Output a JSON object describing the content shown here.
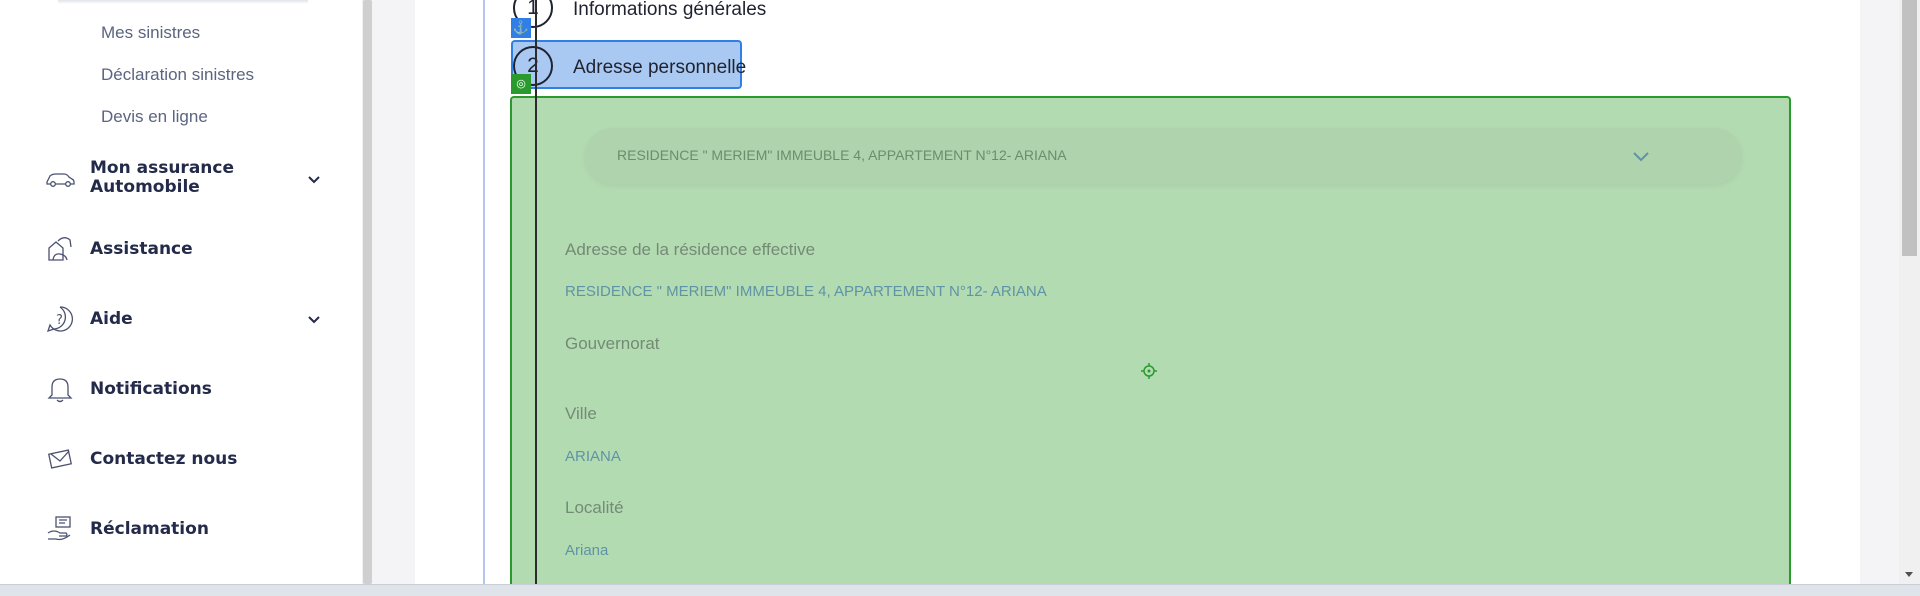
{
  "sidebar": {
    "sub_items": [
      "Mes sinistres",
      "Déclaration sinistres",
      "Devis en ligne"
    ],
    "items": [
      {
        "label_line1": "Mon assurance",
        "label_line2": "Automobile",
        "icon": "car-icon",
        "expandable": true
      },
      {
        "label": "Assistance",
        "icon": "assistance-icon",
        "expandable": false
      },
      {
        "label": "Aide",
        "icon": "help-icon",
        "expandable": true
      },
      {
        "label": "Notifications",
        "icon": "bell-icon",
        "expandable": false
      },
      {
        "label": "Contactez nous",
        "icon": "envelope-icon",
        "expandable": false
      },
      {
        "label": "Réclamation",
        "icon": "complaint-icon",
        "expandable": false
      }
    ]
  },
  "stepper": {
    "steps": [
      {
        "number": "1",
        "label": "Informations générales"
      },
      {
        "number": "2",
        "label": "Adresse personnelle"
      }
    ],
    "badges": {
      "anchor": "⚓",
      "target": "◎"
    }
  },
  "address_form": {
    "select_value": "RESIDENCE \" MERIEM\" IMMEUBLE 4, APPARTEMENT N°12- ARIANA",
    "fields": [
      {
        "label": "Adresse de la résidence effective",
        "value": "RESIDENCE \" MERIEM\" IMMEUBLE 4, APPARTEMENT N°12- ARIANA"
      },
      {
        "label": "Gouvernorat",
        "value": ""
      },
      {
        "label": "Ville",
        "value": "ARIANA"
      },
      {
        "label": "Localité",
        "value": "Ariana"
      }
    ]
  },
  "colors": {
    "panel_green": "#b3dbb2",
    "panel_border": "#2a9a2f",
    "step_highlight": "#a9c9f3",
    "step_border": "#2f7fe6",
    "nav_text": "#232a4a",
    "value_text": "#5f93a6"
  }
}
